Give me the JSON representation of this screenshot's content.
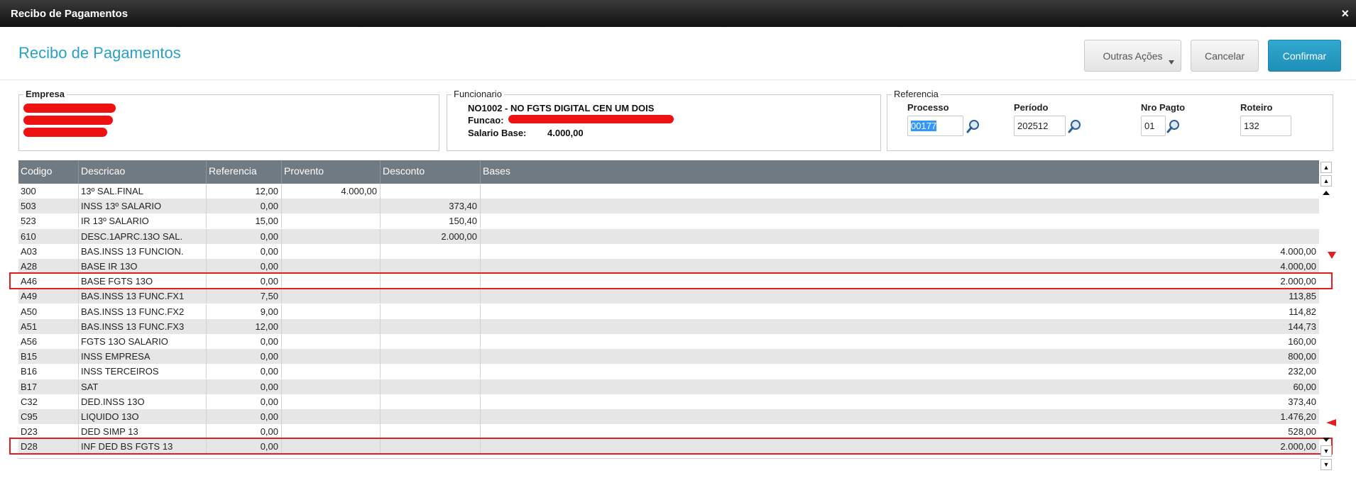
{
  "window": {
    "title": "Recibo de Pagamentos",
    "close_glyph": "×"
  },
  "header": {
    "title": "Recibo de Pagamentos",
    "buttons": {
      "outras": "Outras Ações",
      "cancelar": "Cancelar",
      "confirmar": "Confirmar"
    },
    "accent_color": "#2aa0c6",
    "confirm_color": "#1f9ac3"
  },
  "empresa": {
    "legend": "Empresa"
  },
  "funcionario": {
    "legend": "Funcionario",
    "name": "NO1002 - NO FGTS DIGITAL CEN UM DOIS",
    "funcao_label": "Funcao:",
    "salario_label": "Salario Base:",
    "salario_value": "4.000,00"
  },
  "referencia": {
    "legend": "Referencia",
    "processo": {
      "label": "Processo",
      "value": "00177"
    },
    "periodo": {
      "label": "Período",
      "value": "202512"
    },
    "nro_pagto": {
      "label": "Nro Pagto",
      "value": "01"
    },
    "roteiro": {
      "label": "Roteiro",
      "value": "132"
    }
  },
  "table": {
    "columns": [
      "Codigo",
      "Descricao",
      "Referencia",
      "Provento",
      "Desconto",
      "Bases"
    ],
    "header_color": "#6f7a83",
    "rows": [
      [
        "300",
        "13º SAL.FINAL",
        "12,00",
        "4.000,00",
        "",
        ""
      ],
      [
        "503",
        "INSS 13º SALARIO",
        "0,00",
        "",
        "373,40",
        ""
      ],
      [
        "523",
        "IR 13º SALARIO",
        "15,00",
        "",
        "150,40",
        ""
      ],
      [
        "610",
        "DESC.1APRC.13O SAL.",
        "0,00",
        "",
        "2.000,00",
        ""
      ],
      [
        "A03",
        "BAS.INSS 13 FUNCION.",
        "0,00",
        "",
        "",
        "4.000,00"
      ],
      [
        "A28",
        "BASE IR 13O",
        "0,00",
        "",
        "",
        "4.000,00"
      ],
      [
        "A46",
        "BASE FGTS 13O",
        "0,00",
        "",
        "",
        "2.000,00"
      ],
      [
        "A49",
        "BAS.INSS 13 FUNC.FX1",
        "7,50",
        "",
        "",
        "113,85"
      ],
      [
        "A50",
        "BAS.INSS 13 FUNC.FX2",
        "9,00",
        "",
        "",
        "114,82"
      ],
      [
        "A51",
        "BAS.INSS 13 FUNC.FX3",
        "12,00",
        "",
        "",
        "144,73"
      ],
      [
        "A56",
        "FGTS 13O SALARIO",
        "0,00",
        "",
        "",
        "160,00"
      ],
      [
        "B15",
        "INSS EMPRESA",
        "0,00",
        "",
        "",
        "800,00"
      ],
      [
        "B16",
        "INSS TERCEIROS",
        "0,00",
        "",
        "",
        "232,00"
      ],
      [
        "B17",
        "SAT",
        "0,00",
        "",
        "",
        "60,00"
      ],
      [
        "C32",
        "DED.INSS 13O",
        "0,00",
        "",
        "",
        "373,40"
      ],
      [
        "C95",
        "LIQUIDO 13O",
        "0,00",
        "",
        "",
        "1.476,20"
      ],
      [
        "D23",
        "DED SIMP 13",
        "0,00",
        "",
        "",
        "528,00"
      ],
      [
        "D28",
        "INF DED BS FGTS 13",
        "0,00",
        "",
        "",
        "2.000,00"
      ]
    ],
    "highlighted_codes": [
      "A46",
      "D28"
    ],
    "highlight_color": "#e41e1e"
  },
  "icons": {
    "lookup": "magnifier-icon",
    "scroll_top": "scroll-first-icon",
    "scroll_pageup": "scroll-pageup-icon",
    "scroll_last": "scroll-last-icon"
  }
}
